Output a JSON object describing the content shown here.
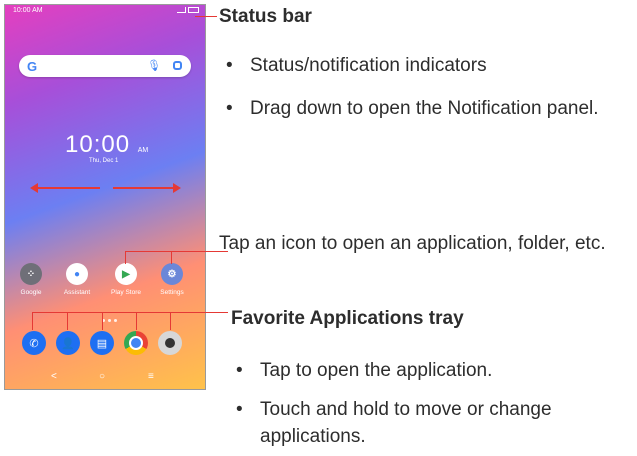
{
  "phone": {
    "status_time": "10:00 AM",
    "clock_time": "10:00",
    "clock_ampm": "AM",
    "date": "Thu, Dec 1",
    "search_logo": "G",
    "apps": [
      {
        "label": "Google",
        "icon": "google-folder-icon",
        "color": "#6f6f78"
      },
      {
        "label": "Assistant",
        "icon": "assistant-icon",
        "color": "#ffffff"
      },
      {
        "label": "Play Store",
        "icon": "play-store-icon",
        "color": "#ffffff"
      },
      {
        "label": "Settings",
        "icon": "settings-icon",
        "color": "#6b87d8"
      }
    ],
    "favorites": [
      {
        "icon": "phone-icon",
        "color": "#1e6ff2"
      },
      {
        "icon": "contacts-icon",
        "color": "#1e6ff2"
      },
      {
        "icon": "messages-icon",
        "color": "#1e6ff2"
      },
      {
        "icon": "chrome-icon",
        "color": "#e0483d"
      },
      {
        "icon": "camera-icon",
        "color": "#d7d7d7"
      }
    ],
    "nav": {
      "back": "<",
      "home": "○",
      "recents": "≡"
    }
  },
  "callouts": {
    "status_bar": {
      "heading": "Status bar",
      "bullets": [
        "Status/notification indicators",
        "Drag down to open the Notification panel."
      ]
    },
    "app_icon": {
      "text": "Tap an icon to open an application, folder, etc."
    },
    "favorites": {
      "heading": "Favorite Applications tray",
      "bullets": [
        "Tap to open the application.",
        "Touch and hold to move or change applications."
      ]
    }
  }
}
